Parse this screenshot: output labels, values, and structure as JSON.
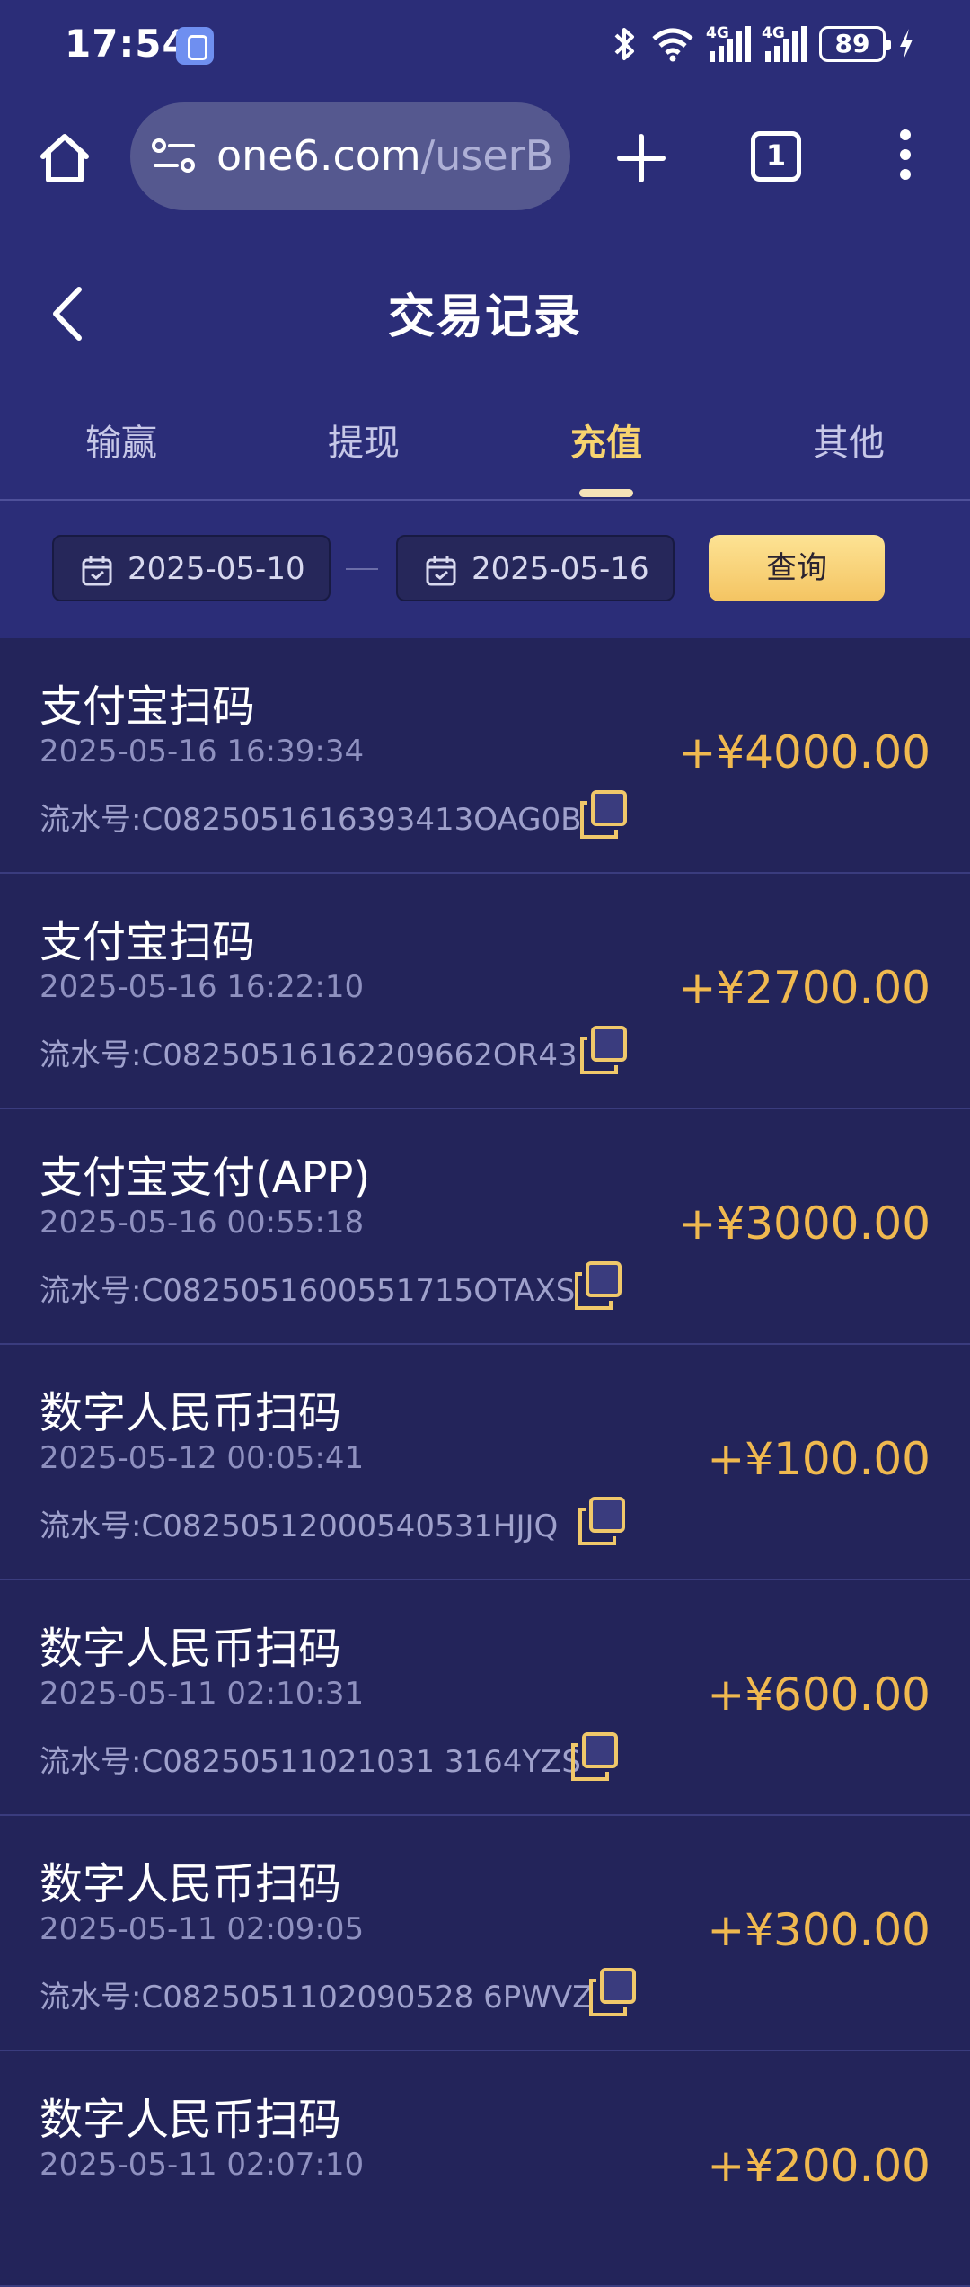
{
  "status_bar": {
    "time": "17:54",
    "network_1": "4G",
    "network_2": "4G",
    "battery": "89"
  },
  "browser": {
    "url_host": "one6.com",
    "url_path": "/userB",
    "tab_count": "1"
  },
  "header": {
    "title": "交易记录"
  },
  "tabs": [
    {
      "label": "输赢"
    },
    {
      "label": "提现"
    },
    {
      "label": "充值"
    },
    {
      "label": "其他"
    }
  ],
  "active_tab": "充值",
  "filter": {
    "start_date": "2025-05-10",
    "end_date": "2025-05-16",
    "query_label": "查询"
  },
  "colors": {
    "background": "#23245a",
    "header": "#2b2d78",
    "accent_gold": "#f0b94f",
    "active_tab": "#f8d46f"
  },
  "records": [
    {
      "title": "支付宝扫码",
      "time": "2025-05-16 16:39:34",
      "serial": "流水号:C0825051616393413OAG0B",
      "amount": "+¥4000.00"
    },
    {
      "title": "支付宝扫码",
      "time": "2025-05-16 16:22:10",
      "serial": "流水号:C08250516162209662OR43",
      "amount": "+¥2700.00"
    },
    {
      "title": "支付宝支付(APP)",
      "time": "2025-05-16 00:55:18",
      "serial": "流水号:C0825051600551715OTAXS",
      "amount": "+¥3000.00"
    },
    {
      "title": "数字人民币扫码",
      "time": "2025-05-12 00:05:41",
      "serial": "流水号:C0825051200054053​1HJJQ",
      "amount": "+¥100.00"
    },
    {
      "title": "数字人民币扫码",
      "time": "2025-05-11 02:10:31",
      "serial": "流水号:C08250511021031 3164YZS",
      "amount": "+¥600.00"
    },
    {
      "title": "数字人民币扫码",
      "time": "2025-05-11 02:09:05",
      "serial": "流水号:C0825051102090528 6PWVZ",
      "amount": "+¥300.00"
    },
    {
      "title": "数字人民币扫码",
      "time": "2025-05-11 02:07:10",
      "serial": "",
      "amount": "+¥200.00"
    }
  ]
}
